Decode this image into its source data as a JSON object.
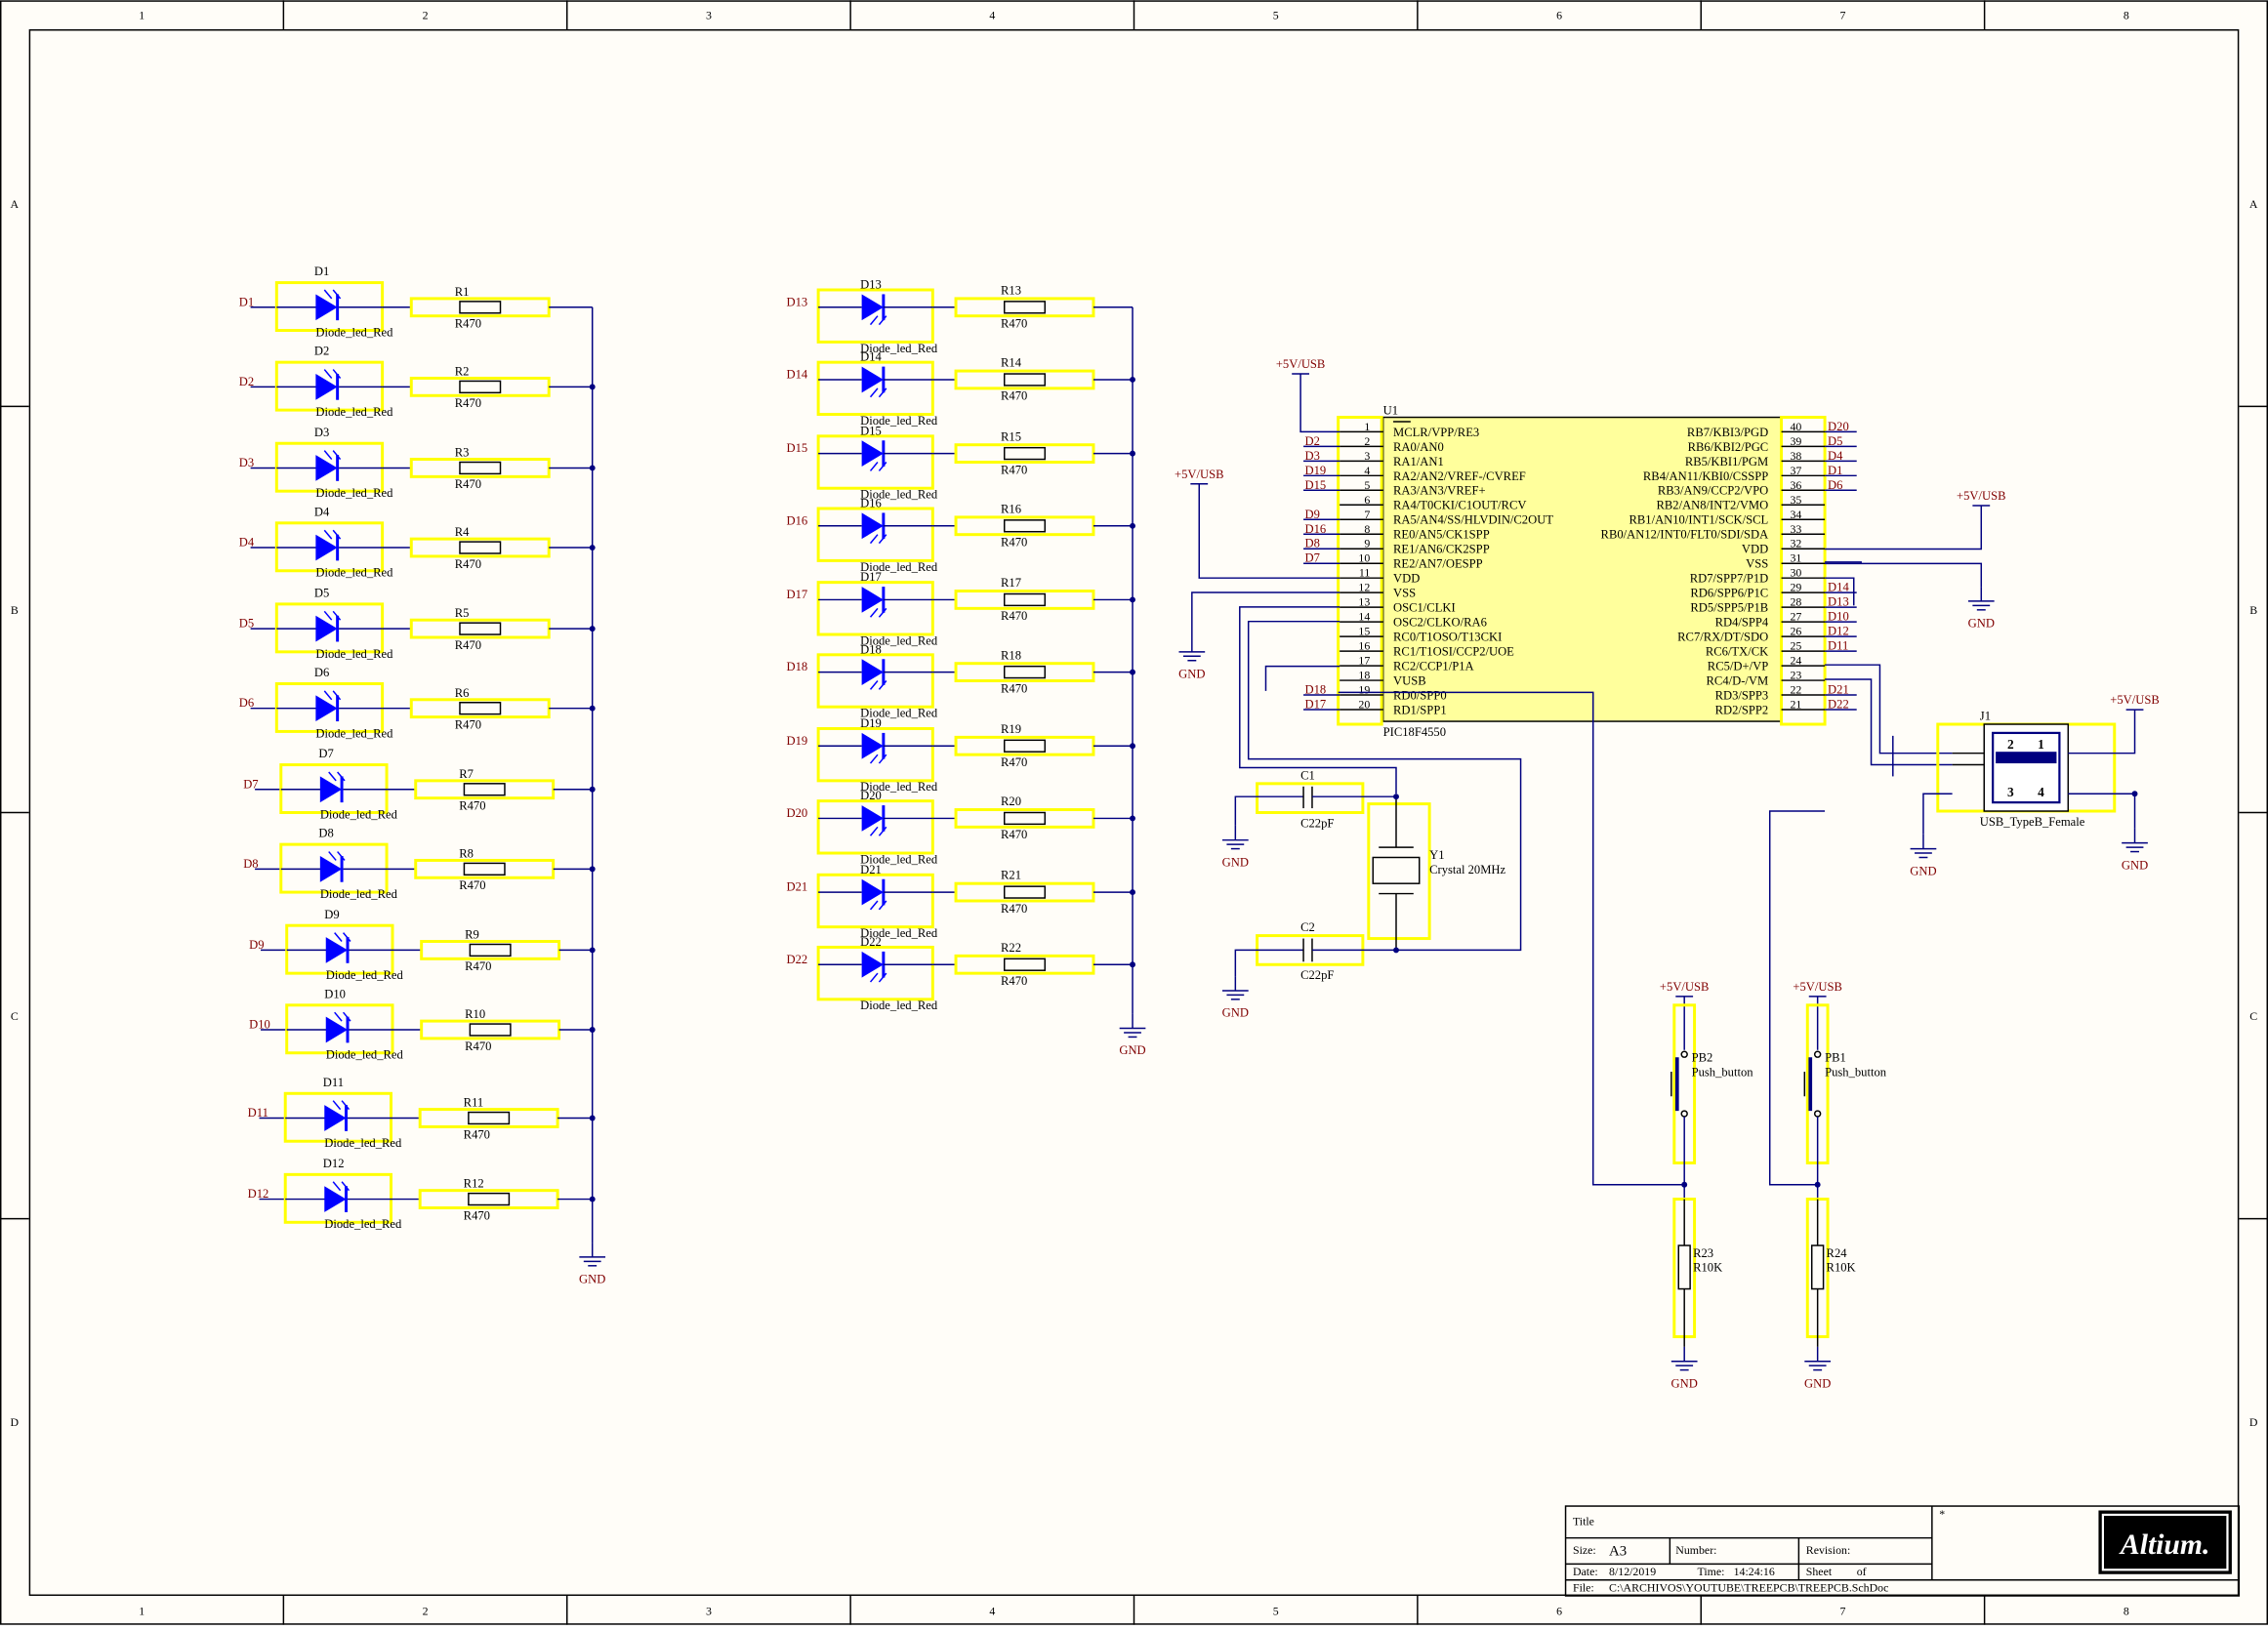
{
  "zones": {
    "cols": [
      "1",
      "2",
      "3",
      "4",
      "5",
      "6",
      "7",
      "8"
    ],
    "rows": [
      "A",
      "B",
      "C",
      "D"
    ]
  },
  "colors": {
    "background": "#fffdf8",
    "border": "#000000",
    "wire": "#000080",
    "net_label": "#800000",
    "component_outline": "#ffff00",
    "ic_fill": "#ffff9c",
    "diode_fill": "#0000ff",
    "text": "#000000"
  },
  "leds_left": [
    {
      "net": "D1",
      "diode": "D1",
      "res": "R1",
      "value": "R470",
      "type": "Diode_led_Red"
    },
    {
      "net": "D2",
      "diode": "D2",
      "res": "R2",
      "value": "R470",
      "type": "Diode_led_Red"
    },
    {
      "net": "D3",
      "diode": "D3",
      "res": "R3",
      "value": "R470",
      "type": "Diode_led_Red"
    },
    {
      "net": "D4",
      "diode": "D4",
      "res": "R4",
      "value": "R470",
      "type": "Diode_led_Red"
    },
    {
      "net": "D5",
      "diode": "D5",
      "res": "R5",
      "value": "R470",
      "type": "Diode_led_Red"
    },
    {
      "net": "D6",
      "diode": "D6",
      "res": "R6",
      "value": "R470",
      "type": "Diode_led_Red"
    },
    {
      "net": "D7",
      "diode": "D7",
      "res": "R7",
      "value": "R470",
      "type": "Diode_led_Red"
    },
    {
      "net": "D8",
      "diode": "D8",
      "res": "R8",
      "value": "R470",
      "type": "Diode_led_Red"
    },
    {
      "net": "D9",
      "diode": "D9",
      "res": "R9",
      "value": "R470",
      "type": "Diode_led_Red"
    },
    {
      "net": "D10",
      "diode": "D10",
      "res": "R10",
      "value": "R470",
      "type": "Diode_led_Red"
    },
    {
      "net": "D11",
      "diode": "D11",
      "res": "R11",
      "value": "R470",
      "type": "Diode_led_Red"
    },
    {
      "net": "D12",
      "diode": "D12",
      "res": "R12",
      "value": "R470",
      "type": "Diode_led_Red"
    }
  ],
  "leds_right": [
    {
      "net": "D13",
      "diode": "D13",
      "res": "R13",
      "value": "R470",
      "type": "Diode_led_Red"
    },
    {
      "net": "D14",
      "diode": "D14",
      "res": "R14",
      "value": "R470",
      "type": "Diode_led_Red"
    },
    {
      "net": "D15",
      "diode": "D15",
      "res": "R15",
      "value": "R470",
      "type": "Diode_led_Red"
    },
    {
      "net": "D16",
      "diode": "D16",
      "res": "R16",
      "value": "R470",
      "type": "Diode_led_Red"
    },
    {
      "net": "D17",
      "diode": "D17",
      "res": "R17",
      "value": "R470",
      "type": "Diode_led_Red"
    },
    {
      "net": "D18",
      "diode": "D18",
      "res": "R18",
      "value": "R470",
      "type": "Diode_led_Red"
    },
    {
      "net": "D19",
      "diode": "D19",
      "res": "R19",
      "value": "R470",
      "type": "Diode_led_Red"
    },
    {
      "net": "D20",
      "diode": "D20",
      "res": "R20",
      "value": "R470",
      "type": "Diode_led_Red"
    },
    {
      "net": "D21",
      "diode": "D21",
      "res": "R21",
      "value": "R470",
      "type": "Diode_led_Red"
    },
    {
      "net": "D22",
      "diode": "D22",
      "res": "R22",
      "value": "R470",
      "type": "Diode_led_Red"
    }
  ],
  "gnd_label": "GND",
  "usb_power_label": "+5V/USB",
  "mcu": {
    "designator": "U1",
    "part": "PIC18F4550",
    "left_pins": [
      {
        "num": "1",
        "name": "MCLR/VPP/RE3",
        "net": ""
      },
      {
        "num": "2",
        "name": "RA0/AN0",
        "net": "D2"
      },
      {
        "num": "3",
        "name": "RA1/AN1",
        "net": "D3"
      },
      {
        "num": "4",
        "name": "RA2/AN2/VREF-/CVREF",
        "net": "D19"
      },
      {
        "num": "5",
        "name": "RA3/AN3/VREF+",
        "net": "D15"
      },
      {
        "num": "6",
        "name": "RA4/T0CKI/C1OUT/RCV",
        "net": ""
      },
      {
        "num": "7",
        "name": "RA5/AN4/SS/HLVDIN/C2OUT",
        "net": "D9"
      },
      {
        "num": "8",
        "name": "RE0/AN5/CK1SPP",
        "net": "D16"
      },
      {
        "num": "9",
        "name": "RE1/AN6/CK2SPP",
        "net": "D8"
      },
      {
        "num": "10",
        "name": "RE2/AN7/OESPP",
        "net": "D7"
      },
      {
        "num": "11",
        "name": "VDD",
        "net": ""
      },
      {
        "num": "12",
        "name": "VSS",
        "net": ""
      },
      {
        "num": "13",
        "name": "OSC1/CLKI",
        "net": ""
      },
      {
        "num": "14",
        "name": "OSC2/CLKO/RA6",
        "net": ""
      },
      {
        "num": "15",
        "name": "RC0/T1OSO/T13CKI",
        "net": ""
      },
      {
        "num": "16",
        "name": "RC1/T1OSI/CCP2/UOE",
        "net": ""
      },
      {
        "num": "17",
        "name": "RC2/CCP1/P1A",
        "net": ""
      },
      {
        "num": "18",
        "name": "VUSB",
        "net": ""
      },
      {
        "num": "19",
        "name": "RD0/SPP0",
        "net": "D18"
      },
      {
        "num": "20",
        "name": "RD1/SPP1",
        "net": "D17"
      }
    ],
    "right_pins": [
      {
        "num": "40",
        "name": "RB7/KBI3/PGD",
        "net": "D20"
      },
      {
        "num": "39",
        "name": "RB6/KBI2/PGC",
        "net": "D5"
      },
      {
        "num": "38",
        "name": "RB5/KBI1/PGM",
        "net": "D4"
      },
      {
        "num": "37",
        "name": "RB4/AN11/KBI0/CSSPP",
        "net": "D1"
      },
      {
        "num": "36",
        "name": "RB3/AN9/CCP2/VPO",
        "net": "D6"
      },
      {
        "num": "35",
        "name": "RB2/AN8/INT2/VMO",
        "net": ""
      },
      {
        "num": "34",
        "name": "RB1/AN10/INT1/SCK/SCL",
        "net": ""
      },
      {
        "num": "33",
        "name": "RB0/AN12/INT0/FLT0/SDI/SDA",
        "net": ""
      },
      {
        "num": "32",
        "name": "VDD",
        "net": ""
      },
      {
        "num": "31",
        "name": "VSS",
        "net": ""
      },
      {
        "num": "30",
        "name": "RD7/SPP7/P1D",
        "net": ""
      },
      {
        "num": "29",
        "name": "RD6/SPP6/P1C",
        "net": "D14"
      },
      {
        "num": "28",
        "name": "RD5/SPP5/P1B",
        "net": "D13"
      },
      {
        "num": "27",
        "name": "RD4/SPP4",
        "net": "D10"
      },
      {
        "num": "26",
        "name": "RC7/RX/DT/SDO",
        "net": "D12"
      },
      {
        "num": "25",
        "name": "RC6/TX/CK",
        "net": "D11"
      },
      {
        "num": "24",
        "name": "RC5/D+/VP",
        "net": ""
      },
      {
        "num": "23",
        "name": "RC4/D-/VM",
        "net": ""
      },
      {
        "num": "22",
        "name": "RD3/SPP3",
        "net": "D21"
      },
      {
        "num": "21",
        "name": "RD2/SPP2",
        "net": "D22"
      }
    ]
  },
  "c1": {
    "designator": "C1",
    "value": "C22pF"
  },
  "c2": {
    "designator": "C2",
    "value": "C22pF"
  },
  "y1": {
    "designator": "Y1",
    "value": "Crystal 20MHz"
  },
  "j1": {
    "designator": "J1",
    "part": "USB_TypeB_Female",
    "pins": [
      "2",
      "1",
      "3",
      "4"
    ]
  },
  "pb2": {
    "designator": "PB2",
    "value": "Push_button"
  },
  "pb1": {
    "designator": "PB1",
    "value": "Push_button"
  },
  "r23": {
    "designator": "R23",
    "value": "R10K"
  },
  "r24": {
    "designator": "R24",
    "value": "R10K"
  },
  "title_block": {
    "title_label": "Title",
    "size_label": "Size:",
    "size_value": "A3",
    "number_label": "Number:",
    "revision_label": "Revision:",
    "date_label": "Date:",
    "date_value": "8/12/2019",
    "time_label": "Time:",
    "time_value": "14:24:16",
    "sheet_label": "Sheet",
    "of_label": "of",
    "file_label": "File:",
    "file_value": "C:\\ARCHIVOS\\YOUTUBE\\TREEPCB\\TREEPCB.SchDoc",
    "star": "*",
    "logo_text": "Altium."
  }
}
